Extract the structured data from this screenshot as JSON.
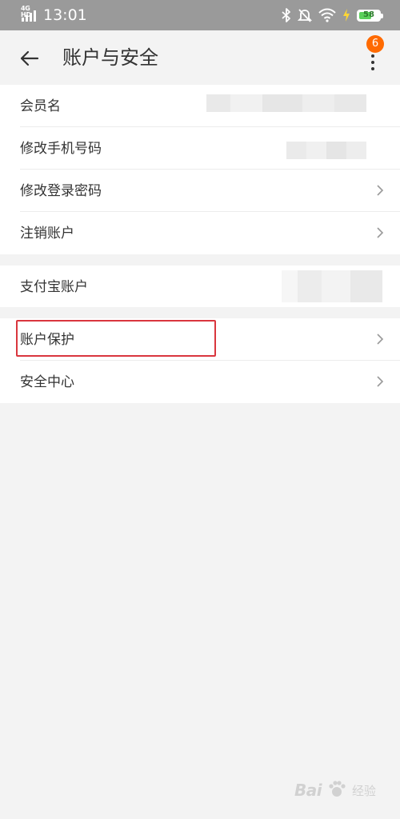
{
  "status_bar": {
    "network": "4G HD",
    "time": "13:01",
    "battery_level": "58",
    "icons": [
      "bluetooth-icon",
      "mute-icon",
      "wifi-icon",
      "charging-icon",
      "battery-icon"
    ]
  },
  "header": {
    "back_icon": "back-arrow-icon",
    "title": "账户与安全",
    "more_icon": "more-vertical-icon",
    "badge_count": "6"
  },
  "group1": {
    "items": [
      {
        "label": "会员名",
        "value": "",
        "value_hidden": true
      },
      {
        "label": "修改手机号码",
        "value": "",
        "value_hidden": true
      },
      {
        "label": "修改登录密码",
        "icon": "chevron-right-icon"
      },
      {
        "label": "注销账户",
        "icon": "chevron-right-icon"
      }
    ]
  },
  "group2": {
    "items": [
      {
        "label": "支付宝账户",
        "value": "",
        "value_hidden": true
      }
    ]
  },
  "group3": {
    "items": [
      {
        "label": "账户保护",
        "icon": "chevron-right-icon",
        "highlighted": true
      },
      {
        "label": "安全中心",
        "icon": "chevron-right-icon"
      }
    ]
  },
  "colors": {
    "status_bar_bg": "#9a9a9a",
    "page_bg": "#f3f3f3",
    "badge": "#ff6a00",
    "highlight_border": "#d9363e"
  },
  "watermark": {
    "text": "Bai",
    "sub": "经验"
  }
}
